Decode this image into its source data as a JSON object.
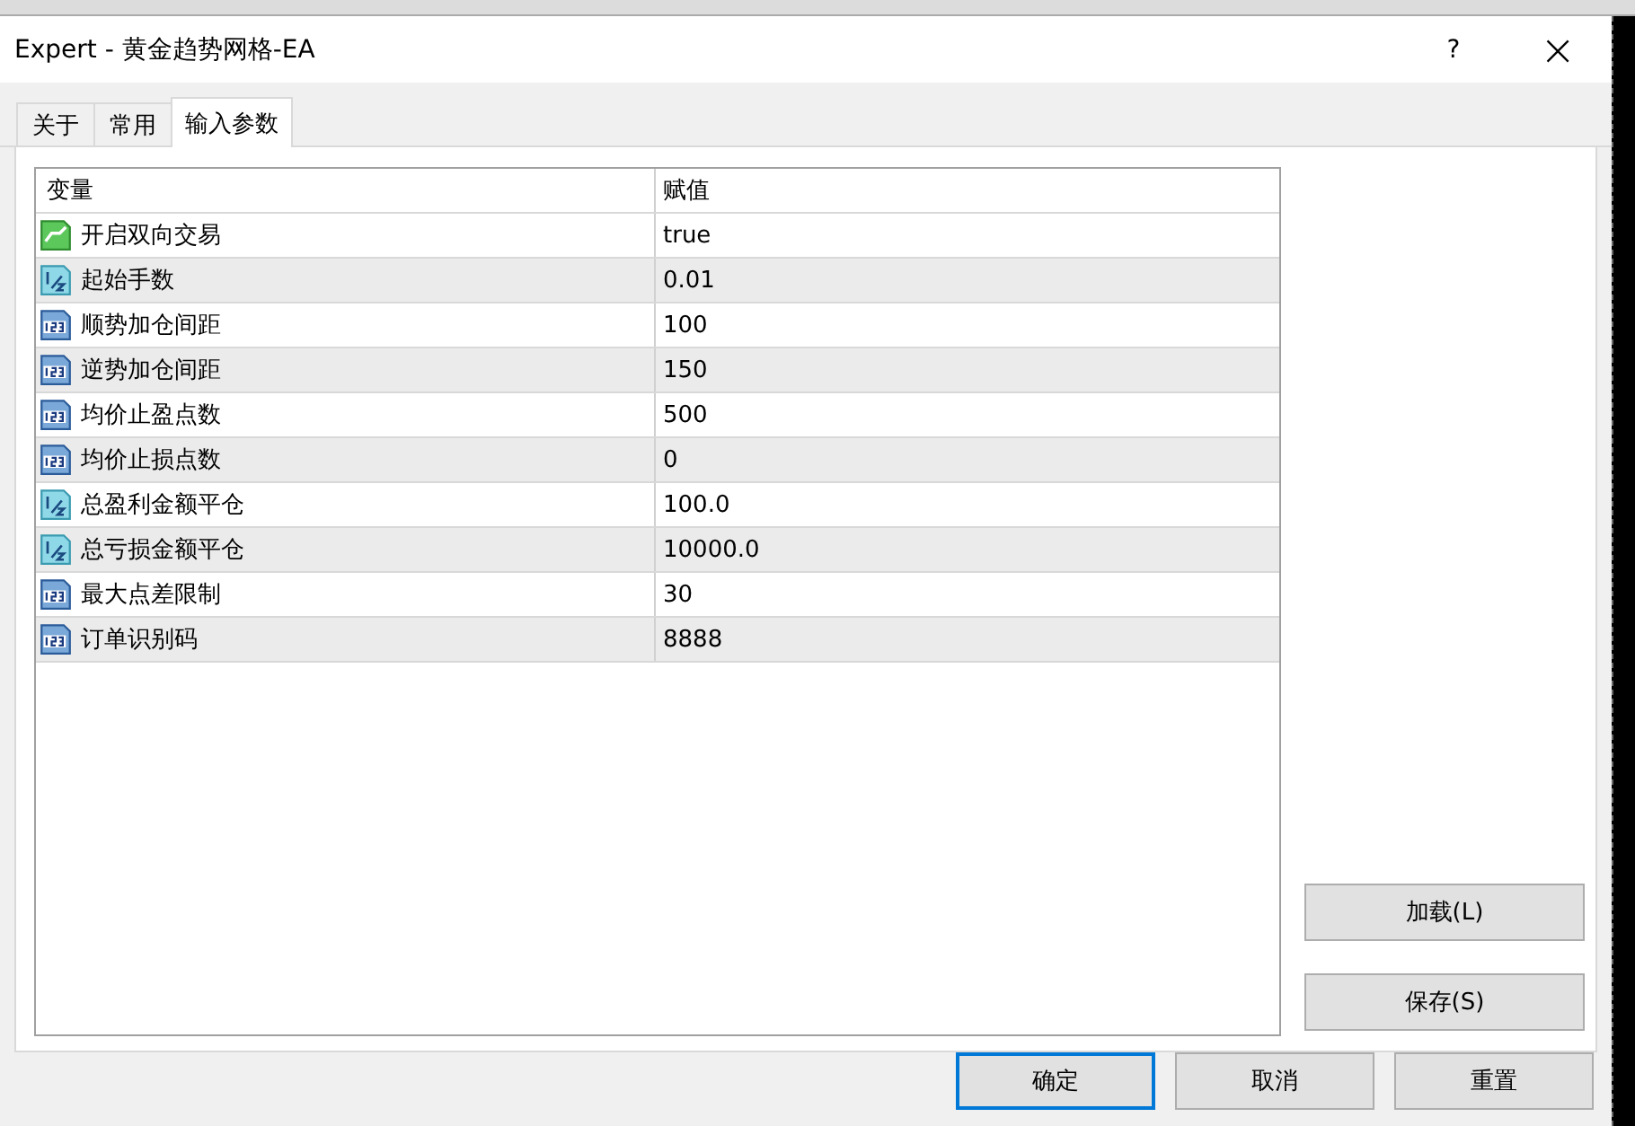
{
  "window": {
    "title": "Expert - 黄金趋势网格-EA",
    "help": "?",
    "close": "×"
  },
  "tabs": [
    {
      "label": "关于",
      "selected": false
    },
    {
      "label": "常用",
      "selected": false
    },
    {
      "label": "输入参数",
      "selected": true
    }
  ],
  "table": {
    "columns": [
      "变量",
      "赋值"
    ],
    "rows": [
      {
        "kind": "bool",
        "name": "开启双向交易",
        "value": "true"
      },
      {
        "kind": "double",
        "name": "起始手数",
        "value": "0.01"
      },
      {
        "kind": "int",
        "name": "顺势加仓间距",
        "value": "100"
      },
      {
        "kind": "int",
        "name": "逆势加仓间距",
        "value": "150"
      },
      {
        "kind": "int",
        "name": "均价止盈点数",
        "value": "500"
      },
      {
        "kind": "int",
        "name": "均价止损点数",
        "value": "0"
      },
      {
        "kind": "double",
        "name": "总盈利金额平仓",
        "value": "100.0"
      },
      {
        "kind": "double",
        "name": "总亏损金额平仓",
        "value": "10000.0"
      },
      {
        "kind": "int",
        "name": "最大点差限制",
        "value": "30"
      },
      {
        "kind": "int",
        "name": "订单识别码",
        "value": "8888"
      }
    ]
  },
  "side_buttons": [
    "加载(L)",
    "保存(S)"
  ],
  "buttons": [
    {
      "label": "确定",
      "default": true
    },
    {
      "label": "取消",
      "default": false
    },
    {
      "label": "重置",
      "default": false
    }
  ]
}
